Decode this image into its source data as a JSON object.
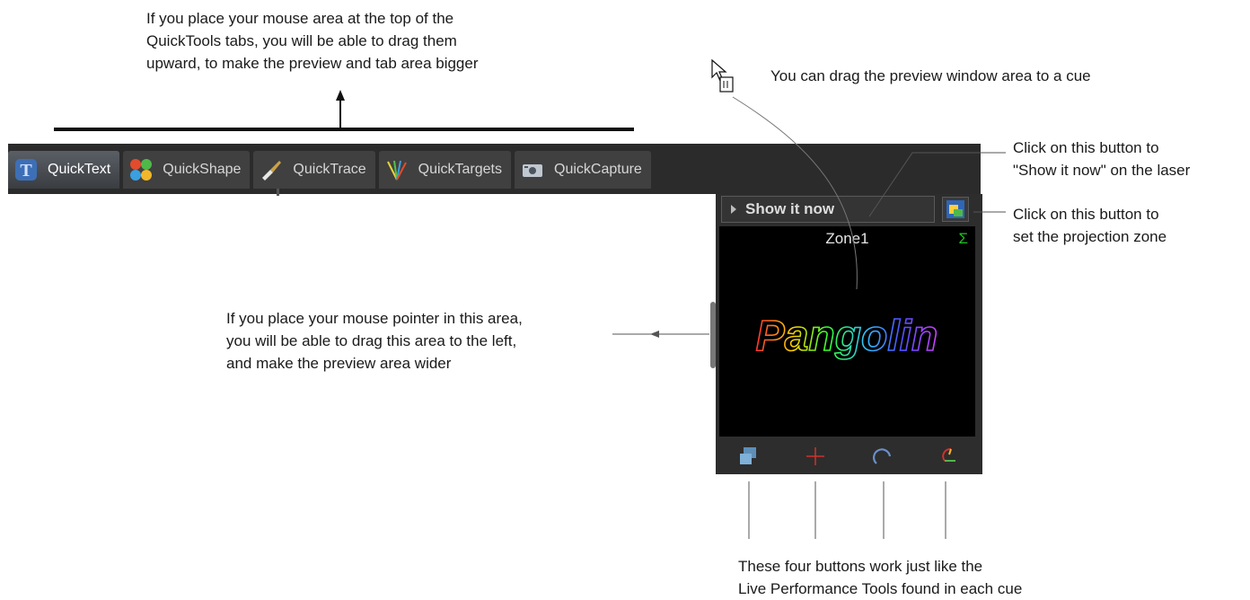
{
  "notes": {
    "drag_top": [
      "If you place your mouse area at the top of the",
      "QuickTools tabs, you will be able to drag them",
      "upward, to make the preview and tab area bigger"
    ],
    "drag_cue": "You can drag the preview window area to a cue",
    "show_now": [
      "Click on this button to",
      "\"Show it now\" on the laser"
    ],
    "zone": [
      "Click on this button to",
      "set the projection zone"
    ],
    "drag_left": [
      "If you place your mouse pointer in this area,",
      "you will be able to drag this area to the left,",
      "and make the preview area wider"
    ],
    "four_buttons": [
      "These four buttons work just like the",
      "Live Performance Tools found in each cue"
    ]
  },
  "tabs": [
    {
      "label": "QuickText",
      "icon": "text-t-icon"
    },
    {
      "label": "QuickShape",
      "icon": "shapes-icon"
    },
    {
      "label": "QuickTrace",
      "icon": "brush-icon"
    },
    {
      "label": "QuickTargets",
      "icon": "beams-icon"
    },
    {
      "label": "QuickCapture",
      "icon": "camera-icon"
    }
  ],
  "preview": {
    "show_button": "Show it now",
    "zone_label": "Zone1",
    "sigma": "Σ",
    "laser_text": "Pangolin"
  },
  "colors": {
    "accent": "#22c222",
    "panel": "#2d2d2d",
    "canvas": "#000000"
  }
}
